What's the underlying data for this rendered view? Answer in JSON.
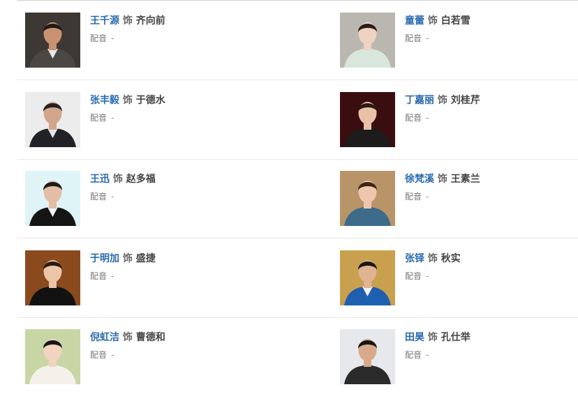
{
  "cast": [
    {
      "actor": "王千源",
      "as": "饰",
      "role": "齐向前",
      "dub_label": "配音",
      "dub_value": "-",
      "photo": {
        "bg": "#3d3833",
        "skin": "#c99273",
        "hair": "#1e1a17",
        "cloth": "#e8e8e6",
        "jacket": "#4a4744"
      }
    },
    {
      "actor": "童蕾",
      "as": "饰",
      "role": "白若雪",
      "dub_label": "配音",
      "dub_value": "-",
      "photo": {
        "bg": "#b9b7b0",
        "skin": "#efd2c2",
        "hair": "#2a1e19",
        "cloth": "#d9e6dc",
        "jacket": "#d9e6dc"
      }
    },
    {
      "actor": "张丰毅",
      "as": "饰",
      "role": "于德水",
      "dub_label": "配音",
      "dub_value": "-",
      "photo": {
        "bg": "#ececec",
        "skin": "#d2a58c",
        "hair": "#222222",
        "cloth": "#e4e4e4",
        "jacket": "#202226"
      }
    },
    {
      "actor": "丁嘉丽",
      "as": "饰",
      "role": "刘桂芹",
      "dub_label": "配音",
      "dub_value": "-",
      "photo": {
        "bg": "#3a0e0e",
        "skin": "#e8c2a8",
        "hair": "#2a1a14",
        "cloth": "#1c1c1c",
        "jacket": "#1c1c1c"
      }
    },
    {
      "actor": "王迅",
      "as": "饰",
      "role": "赵多福",
      "dub_label": "配音",
      "dub_value": "-",
      "photo": {
        "bg": "#dff4f6",
        "skin": "#e3bea4",
        "hair": "#1c1c1c",
        "cloth": "#f4f4f4",
        "jacket": "#151515"
      }
    },
    {
      "actor": "徐梵溪",
      "as": "饰",
      "role": "王素兰",
      "dub_label": "配音",
      "dub_value": "-",
      "photo": {
        "bg": "#b89468",
        "skin": "#eec6ac",
        "hair": "#3a2618",
        "cloth": "#3c6c8a",
        "jacket": "#3c6c8a"
      }
    },
    {
      "actor": "于明加",
      "as": "饰",
      "role": "盛捷",
      "dub_label": "配音",
      "dub_value": "-",
      "photo": {
        "bg": "#8a4a1e",
        "skin": "#ecc5a9",
        "hair": "#2a1a12",
        "cloth": "#121212",
        "jacket": "#121212"
      }
    },
    {
      "actor": "张铎",
      "as": "饰",
      "role": "秋实",
      "dub_label": "配音",
      "dub_value": "-",
      "photo": {
        "bg": "#c9a04e",
        "skin": "#e0b393",
        "hair": "#1a1612",
        "cloth": "#f2f2f2",
        "jacket": "#1f5fb0"
      }
    },
    {
      "actor": "倪虹洁",
      "as": "饰",
      "role": "曹德和",
      "dub_label": "配音",
      "dub_value": "-",
      "photo": {
        "bg": "#c8d6a6",
        "skin": "#f1d3c0",
        "hair": "#161616",
        "cloth": "#f4f1ea",
        "jacket": "#f4f1ea"
      }
    },
    {
      "actor": "田昊",
      "as": "饰",
      "role": "孔仕举",
      "dub_label": "配音",
      "dub_value": "-",
      "photo": {
        "bg": "#e6e8ec",
        "skin": "#d7a98a",
        "hair": "#151515",
        "cloth": "#2b2b2b",
        "jacket": "#2b2b2b"
      }
    }
  ],
  "colors": {
    "actor_link": "#2a6aae",
    "text": "#666666",
    "divider": "#e8e8e8"
  }
}
